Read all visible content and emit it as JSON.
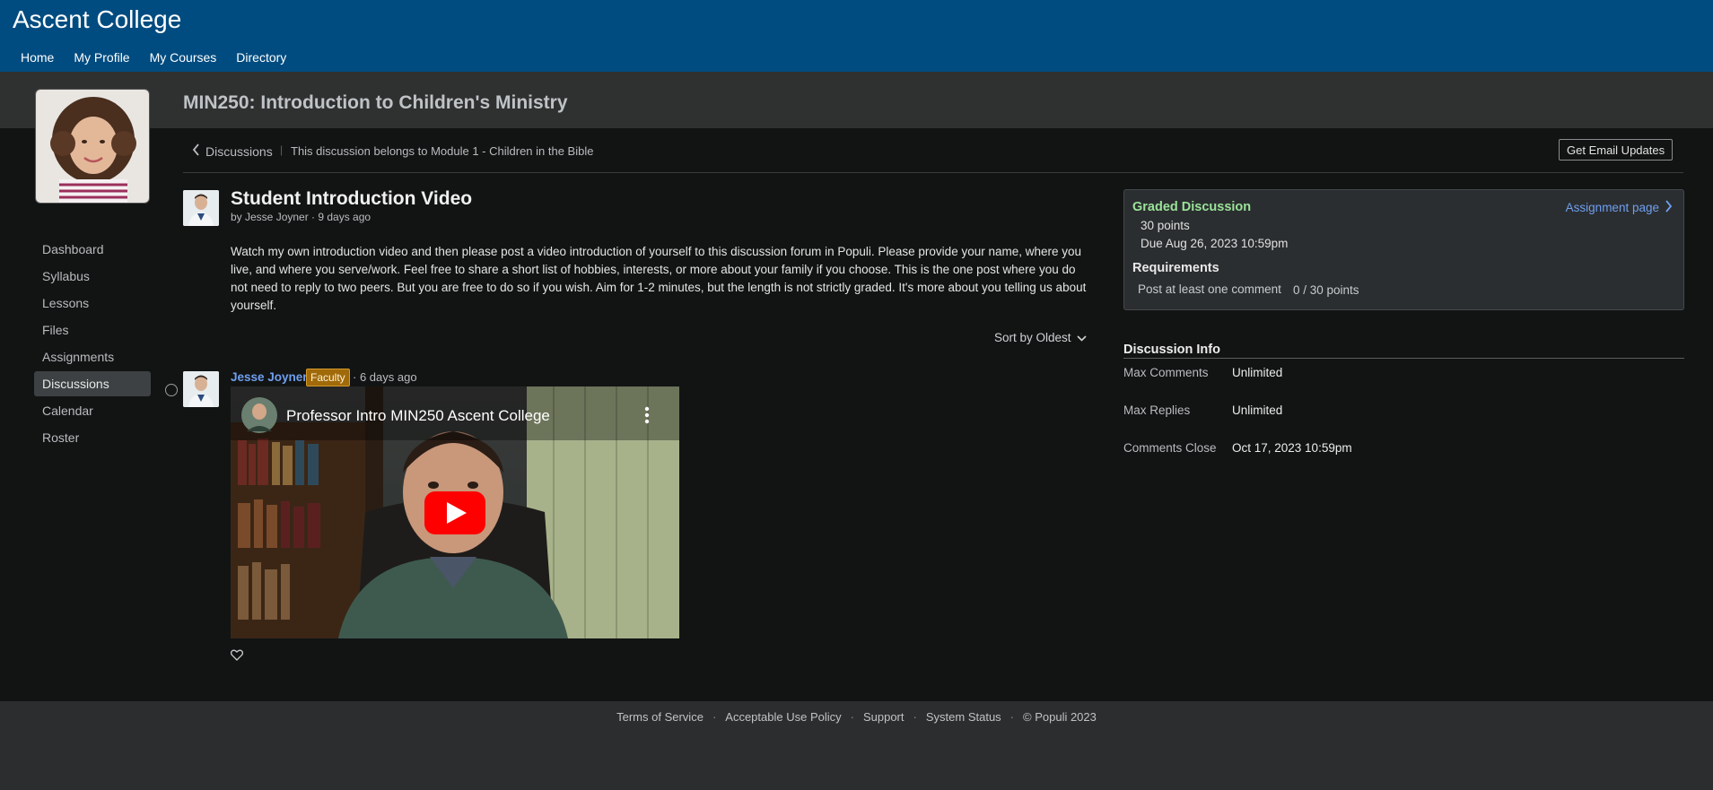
{
  "header": {
    "brand": "Ascent College",
    "nav": [
      "Home",
      "My Profile",
      "My Courses",
      "Directory"
    ]
  },
  "course": {
    "title": "MIN250: Introduction to Children's Ministry"
  },
  "sidebar": {
    "items": [
      {
        "label": "Dashboard",
        "active": false
      },
      {
        "label": "Syllabus",
        "active": false
      },
      {
        "label": "Lessons",
        "active": false
      },
      {
        "label": "Files",
        "active": false
      },
      {
        "label": "Assignments",
        "active": false
      },
      {
        "label": "Discussions",
        "active": true
      },
      {
        "label": "Calendar",
        "active": false
      },
      {
        "label": "Roster",
        "active": false
      }
    ]
  },
  "breadcrumb": {
    "back_label": "Discussions",
    "separator": "|",
    "module_note": "This discussion belongs to Module 1 - Children in the Bible",
    "email_button": "Get Email Updates"
  },
  "discussion": {
    "title": "Student Introduction Video",
    "meta": "by Jesse Joyner · 9 days ago",
    "body": "Watch my own introduction video and then please post a video introduction of yourself to this discussion forum in Populi. Please provide your name, where you live, and where you serve/work. Feel free to share a short list of hobbies, interests, or more about your family if you choose. This is the one post where you do not need to reply to two peers. But you are free to do so if you wish. Aim for 1-2 minutes, but the length is not strictly graded. It's more about you telling us about yourself.",
    "sort_label": "Sort by Oldest"
  },
  "comment": {
    "author": "Jesse Joyner",
    "badge": "Faculty",
    "time": "· 6 days ago",
    "video_title": "Professor Intro MIN250 Ascent College"
  },
  "graded": {
    "title": "Graded Discussion",
    "link": "Assignment page",
    "points": "30 points",
    "due": "Due Aug 26, 2023 10:59pm",
    "requirements_title": "Requirements",
    "requirement": "Post at least one comment",
    "requirement_progress": "0 / 30 points"
  },
  "info": {
    "title": "Discussion Info",
    "rows": [
      {
        "label": "Max Comments",
        "value": "Unlimited"
      },
      {
        "label": "Max Replies",
        "value": "Unlimited"
      },
      {
        "label": "Comments Close",
        "value": "Oct 17, 2023 10:59pm"
      }
    ]
  },
  "footer": {
    "links": [
      "Terms of Service",
      "Acceptable Use Policy",
      "Support",
      "System Status"
    ],
    "copyright": "© Populi 2023"
  },
  "colors": {
    "header_bg": "#004c80",
    "link_blue": "#6f9ff0",
    "graded_green": "#9be39a",
    "faculty_badge": "#a06a0a",
    "youtube_red": "#ff0000"
  }
}
